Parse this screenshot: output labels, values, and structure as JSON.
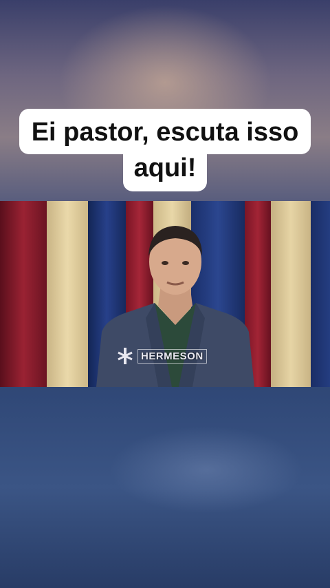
{
  "caption": {
    "line1": "Ei pastor, escuta isso",
    "line2": "aqui!"
  },
  "video": {
    "watermark_text": "HERMESON",
    "watermark_icon": "cross-icon"
  },
  "colors": {
    "caption_bg": "#ffffff",
    "caption_text": "#111111",
    "curtain_red": "#8b1a2a",
    "curtain_blue": "#1f3577",
    "curtain_beige": "#e2cf9f"
  }
}
